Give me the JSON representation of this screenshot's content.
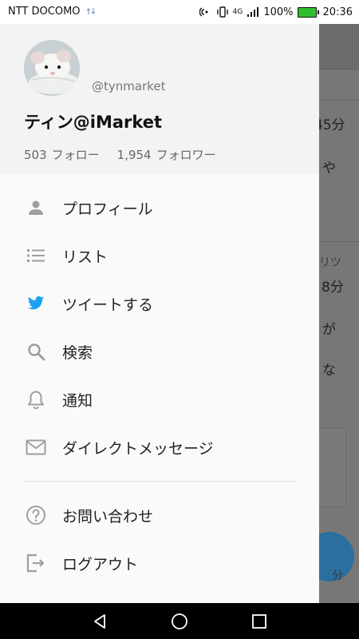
{
  "status_bar": {
    "carrier": "NTT DOCOMO",
    "battery": "100%",
    "time": "20:36",
    "network": "4G"
  },
  "profile": {
    "handle": "@tynmarket",
    "display_name": "ティン@iMarket",
    "following_count": "503",
    "following_label": "フォロー",
    "followers_count": "1,954",
    "followers_label": "フォロワー"
  },
  "menu": [
    {
      "label": "プロフィール",
      "icon": "person-icon"
    },
    {
      "label": "リスト",
      "icon": "list-icon"
    },
    {
      "label": "ツイートする",
      "icon": "twitter-bird-icon"
    },
    {
      "label": "検索",
      "icon": "search-icon"
    },
    {
      "label": "通知",
      "icon": "bell-icon"
    },
    {
      "label": "ダイレクトメッセージ",
      "icon": "mail-icon"
    }
  ],
  "menu_secondary": [
    {
      "label": "お問い合わせ",
      "icon": "help-icon"
    },
    {
      "label": "ログアウト",
      "icon": "logout-icon"
    }
  ],
  "background_fragments": {
    "t1": "45分",
    "t2": "や",
    "t3": "リツ",
    "t4": "8分",
    "t5": "が",
    "t6": "な",
    "t7": "分"
  },
  "colors": {
    "twitter_blue": "#1da1f2",
    "icon_gray": "#9e9e9e",
    "battery_green": "#2fbf2f"
  }
}
